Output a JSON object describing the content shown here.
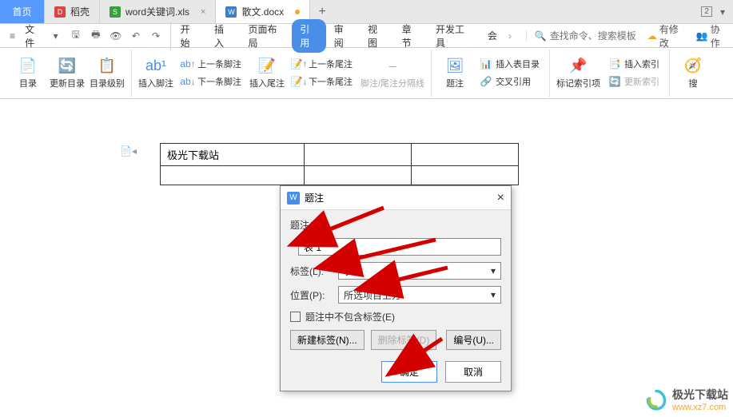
{
  "tabs": {
    "home": "首页",
    "items": [
      {
        "icon": "D",
        "label": "稻壳"
      },
      {
        "icon": "S",
        "label": "word关键词.xls"
      },
      {
        "icon": "W",
        "label": "散文.docx"
      }
    ],
    "right_badge": "2"
  },
  "menu": {
    "file": "文件",
    "tabs": [
      "开始",
      "插入",
      "页面布局",
      "引用",
      "审阅",
      "视图",
      "章节",
      "开发工具",
      "会"
    ],
    "active_index": 3,
    "search_placeholder": "查找命令、搜索模板",
    "right": {
      "unsaved": "有修改",
      "collab": "协作"
    }
  },
  "ribbon": {
    "g1": {
      "toc": "目录",
      "update": "更新目录",
      "level": "目录级别"
    },
    "g2": {
      "insert_footnote": "插入脚注",
      "prev_footnote": "上一条脚注",
      "next_footnote": "下一条脚注",
      "insert_endnote": "插入尾注",
      "prev_endnote": "上一条尾注",
      "next_endnote": "下一条尾注",
      "separator": "脚注/尾注分隔线"
    },
    "g3": {
      "caption": "题注",
      "insert_figtable": "插入表目录",
      "crossref": "交叉引用"
    },
    "g4": {
      "mark_entry": "标记索引项",
      "insert_index": "插入索引",
      "update_index": "更新索引"
    },
    "g5": {
      "search": "搜"
    }
  },
  "document": {
    "table_cell": "极光下载站"
  },
  "dialog": {
    "title": "题注",
    "caption_label": "题注(C):",
    "caption_value": "表 1",
    "label_label": "标签(L):",
    "label_value": "表",
    "position_label": "位置(P):",
    "position_value": "所选项目上方",
    "exclude_label": "题注中不包含标签(E)",
    "new_label_btn": "新建标签(N)...",
    "delete_label_btn": "删除标签(D)",
    "numbering_btn": "编号(U)...",
    "ok": "确定",
    "cancel": "取消"
  },
  "watermark": {
    "name": "极光下载站",
    "url": "www.xz7.com"
  }
}
